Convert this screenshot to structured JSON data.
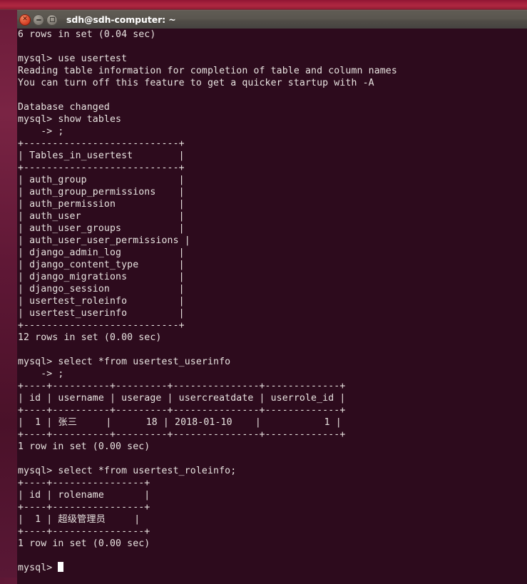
{
  "desktop": {
    "accent_top": "#a3203c",
    "panel_color": "#57534c",
    "wallpaper_color": "#5e1735"
  },
  "window": {
    "title": "sdh@sdh-computer: ~",
    "controls": [
      {
        "name": "close",
        "label": "x"
      },
      {
        "name": "minimize",
        "label": "-"
      },
      {
        "name": "maximize",
        "label": "[]"
      }
    ],
    "background": "#2d0b1d",
    "foreground": "#e8e3e0"
  },
  "terminal": {
    "prompt": "mysql>",
    "continuation_prompt": "    ->",
    "cursor_visible": true,
    "lines": [
      "6 rows in set (0.04 sec)",
      "",
      "mysql> use usertest",
      "Reading table information for completion of table and column names",
      "You can turn off this feature to get a quicker startup with -A",
      "",
      "Database changed",
      "mysql> show tables",
      "    -> ;",
      "+---------------------------+",
      "| Tables_in_usertest        |",
      "+---------------------------+",
      "| auth_group                |",
      "| auth_group_permissions    |",
      "| auth_permission           |",
      "| auth_user                 |",
      "| auth_user_groups          |",
      "| auth_user_user_permissions |",
      "| django_admin_log          |",
      "| django_content_type       |",
      "| django_migrations         |",
      "| django_session            |",
      "| usertest_roleinfo         |",
      "| usertest_userinfo         |",
      "+---------------------------+",
      "12 rows in set (0.00 sec)",
      "",
      "mysql> select *from usertest_userinfo",
      "    -> ;",
      "+----+----------+---------+---------------+-------------+",
      "| id | username | userage | usercreatdate | userrole_id |",
      "+----+----------+---------+---------------+-------------+",
      "|  1 | 张三     |      18 | 2018-01-10    |           1 |",
      "+----+----------+---------+---------------+-------------+",
      "1 row in set (0.00 sec)",
      "",
      "mysql> select *from usertest_roleinfo;",
      "+----+----------------+",
      "| id | rolename       |",
      "+----+----------------+",
      "|  1 | 超级管理员     |",
      "+----+----------------+",
      "1 row in set (0.00 sec)",
      "",
      "mysql> "
    ],
    "commands": [
      "use usertest",
      "show tables",
      "select *from usertest_userinfo",
      "select *from usertest_roleinfo;"
    ],
    "tables_in_usertest": {
      "header": "Tables_in_usertest",
      "rows": [
        "auth_group",
        "auth_group_permissions",
        "auth_permission",
        "auth_user",
        "auth_user_groups",
        "auth_user_user_permissions",
        "django_admin_log",
        "django_content_type",
        "django_migrations",
        "django_session",
        "usertest_roleinfo",
        "usertest_userinfo"
      ],
      "row_count_text": "12 rows in set (0.00 sec)"
    },
    "usertest_userinfo": {
      "columns": [
        "id",
        "username",
        "userage",
        "usercreatdate",
        "userrole_id"
      ],
      "rows": [
        [
          "1",
          "张三",
          "18",
          "2018-01-10",
          "1"
        ]
      ],
      "row_count_text": "1 row in set (0.00 sec)"
    },
    "usertest_roleinfo": {
      "columns": [
        "id",
        "rolename"
      ],
      "rows": [
        [
          "1",
          "超级管理员"
        ]
      ],
      "row_count_text": "1 row in set (0.00 sec)"
    },
    "messages": [
      "6 rows in set (0.04 sec)",
      "Reading table information for completion of table and column names",
      "You can turn off this feature to get a quicker startup with -A",
      "Database changed"
    ]
  }
}
